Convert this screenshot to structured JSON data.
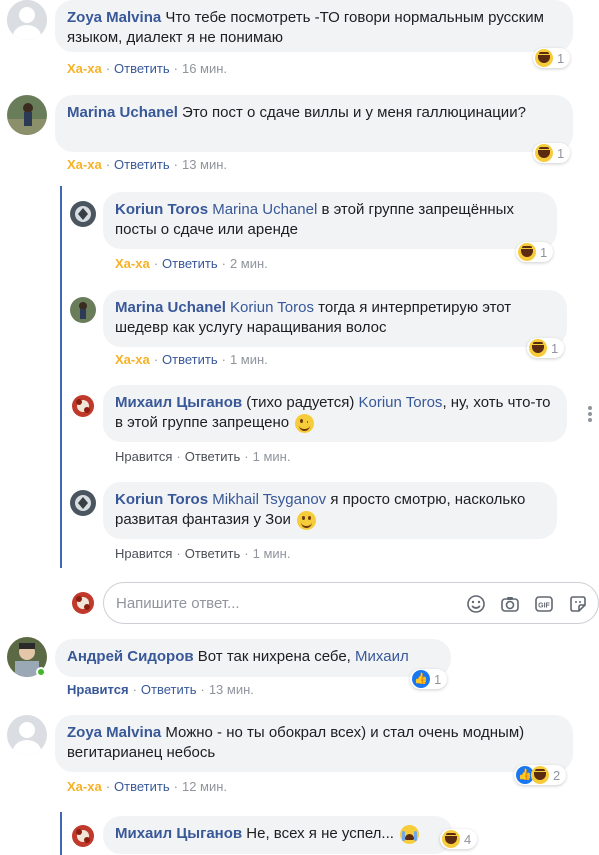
{
  "comments": [
    {
      "author": "Zoya Malvina",
      "text": "Что тебе посмотреть -ТО говори нормальным русским языком, диалект я не понимаю",
      "reaction_label": "Ха-ха",
      "reply_label": "Ответить",
      "time": "16 мин.",
      "reaction_count": "1"
    },
    {
      "author": "Marina Uchanel",
      "text": "Это пост о сдаче виллы и у меня галлюцинации?",
      "reaction_label": "Ха-ха",
      "reply_label": "Ответить",
      "time": "13 мин.",
      "reaction_count": "1"
    },
    {
      "author": "Koriun Toros",
      "mention": "Marina Uchanel",
      "text": "в этой группе запрещённых посты о сдаче или аренде",
      "reaction_label": "Ха-ха",
      "reply_label": "Ответить",
      "time": "2 мин.",
      "reaction_count": "1"
    },
    {
      "author": "Marina Uchanel",
      "mention": "Koriun Toros",
      "text": "тогда я интерпретирую этот шедевр как услугу наращивания волос",
      "reaction_label": "Ха-ха",
      "reply_label": "Ответить",
      "time": "1 мин.",
      "reaction_count": "1"
    },
    {
      "author": "Михаил Цыганов",
      "text_pre": "(тихо радуется)",
      "mention": "Koriun Toros",
      "text": ", ну, хоть что-то в этой группе запрещено",
      "reaction_label": "Нравится",
      "reply_label": "Ответить",
      "time": "1 мин."
    },
    {
      "author": "Koriun Toros",
      "mention": "Mikhail Tsyganov",
      "text": "я просто смотрю, насколько развитая фантазия у Зои",
      "reaction_label": "Нравится",
      "reply_label": "Ответить",
      "time": "1 мин."
    },
    {
      "author": "Андрей Сидоров",
      "text": "Вот так нихрена себе,",
      "mention": "Михаил",
      "reaction_label": "Нравится",
      "reply_label": "Ответить",
      "time": "13 мин.",
      "reaction_count": "1"
    },
    {
      "author": "Zoya Malvina",
      "text": "Можно - но ты обокрал всех) и стал очень модным) вегитарианец небось",
      "reaction_label": "Ха-ха",
      "reply_label": "Ответить",
      "time": "12 мин.",
      "reaction_count": "2"
    },
    {
      "author": "Михаил Цыганов",
      "text": "Не, всех я не успел...",
      "reaction_count": "4"
    }
  ],
  "reply_box": {
    "placeholder": "Напишите ответ..."
  },
  "icons": {
    "emoji": "smiley-icon",
    "camera": "camera-icon",
    "gif": "gif-icon",
    "sticker": "sticker-icon"
  },
  "colors": {
    "author": "#385898",
    "haha": "#f7b125",
    "bubble": "#f2f3f5",
    "thread_line": "#4267b2"
  }
}
